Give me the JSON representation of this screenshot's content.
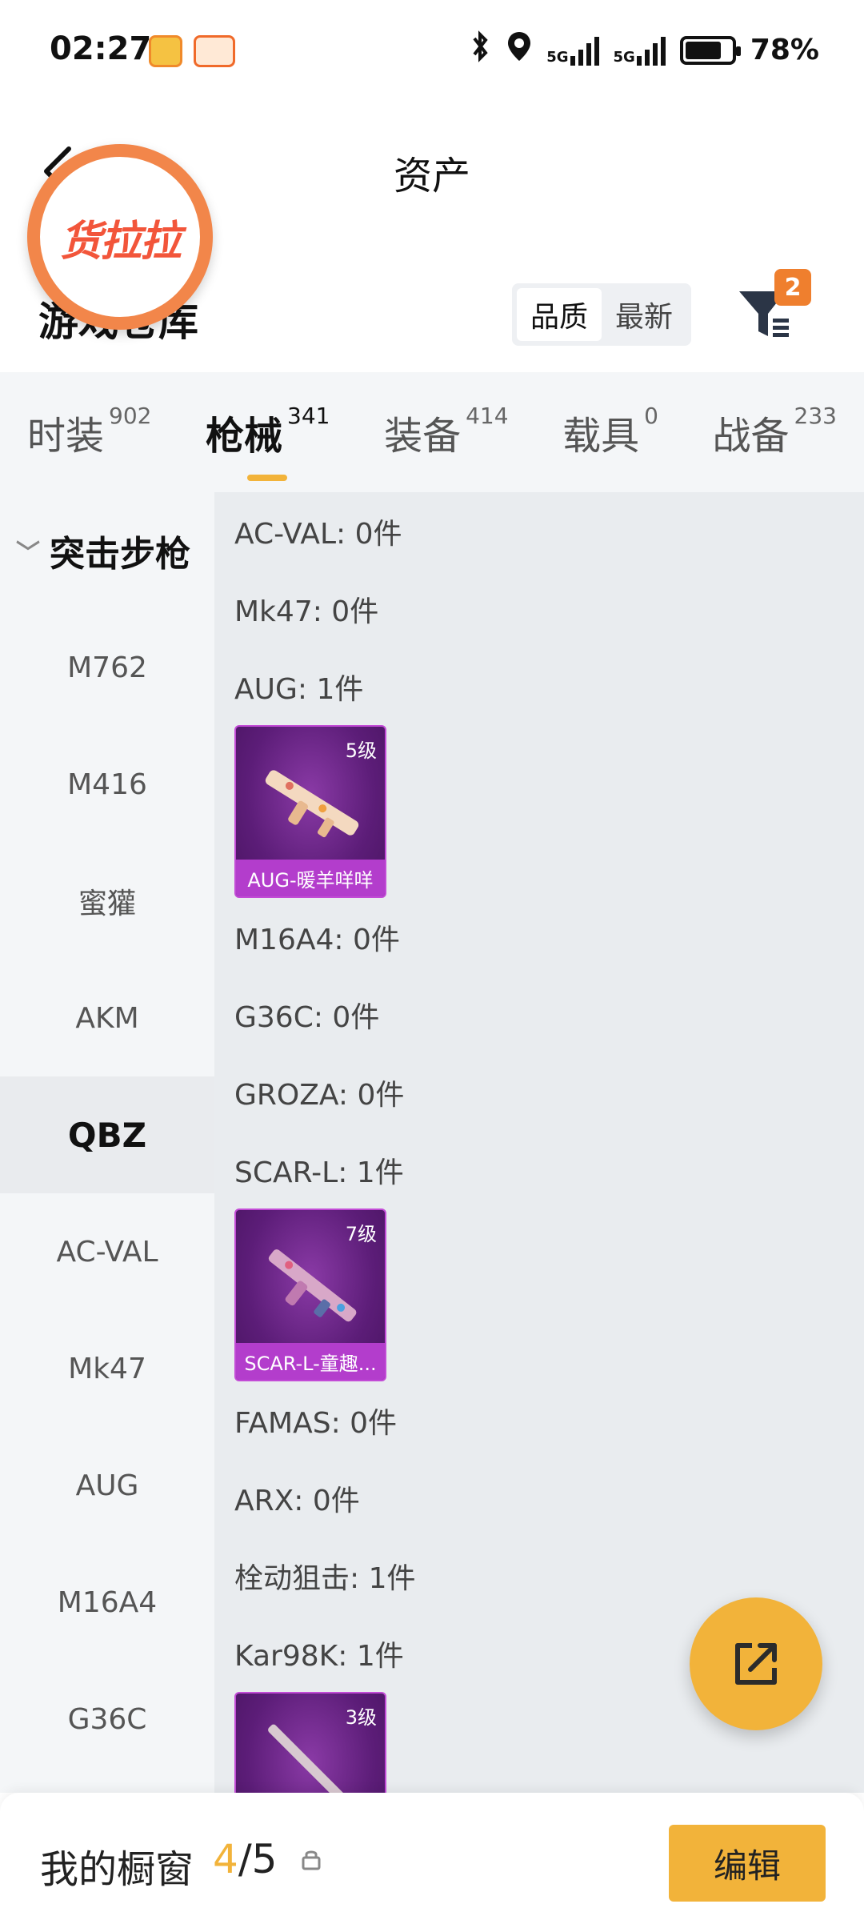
{
  "status_bar": {
    "time": "02:27",
    "network_1": "5G",
    "network_2": "5G",
    "battery_level": 78,
    "battery": "78%"
  },
  "header": {
    "title": "资产",
    "logo_text": "货拉拉",
    "section_title": "游戏仓库",
    "sort_options": [
      "品质",
      "最新"
    ],
    "sort_selected": "品质",
    "filter_badge": "2"
  },
  "tabs": [
    {
      "label": "时装",
      "count": "902"
    },
    {
      "label": "枪械",
      "count": "341"
    },
    {
      "label": "装备",
      "count": "414"
    },
    {
      "label": "载具",
      "count": "0"
    },
    {
      "label": "战备",
      "count": "233"
    }
  ],
  "active_tab": "枪械",
  "sidebar": {
    "category": "突击步枪",
    "items": [
      "M762",
      "M416",
      "蜜獾",
      "AKM",
      "QBZ",
      "AC-VAL",
      "Mk47",
      "AUG",
      "M16A4",
      "G36C"
    ],
    "active": "QBZ"
  },
  "content": {
    "rows": [
      {
        "text": "AC-VAL: 0件"
      },
      {
        "text": "Mk47: 0件"
      },
      {
        "text": "AUG: 1件",
        "card": {
          "level": "5级",
          "name": "AUG-暖羊咩咩"
        }
      },
      {
        "text": "M16A4: 0件"
      },
      {
        "text": "G36C: 0件"
      },
      {
        "text": "GROZA: 0件"
      },
      {
        "text": "SCAR-L: 1件",
        "card": {
          "level": "7级",
          "name": "SCAR-L-童趣..."
        }
      },
      {
        "text": "FAMAS: 0件"
      },
      {
        "text": "ARX: 0件"
      },
      {
        "text": "栓动狙击: 1件"
      },
      {
        "text": "Kar98K: 1件",
        "card": {
          "level": "3级",
          "name": ""
        }
      }
    ]
  },
  "bottom_bar": {
    "title": "我的橱窗",
    "current": "4",
    "separator": "/",
    "total": "5",
    "edit_label": "编辑"
  },
  "colors": {
    "accent": "#f2b33a",
    "card_purple": "#5c1d78",
    "card_label": "#b33dcc",
    "logo_orange": "#f2864a"
  }
}
